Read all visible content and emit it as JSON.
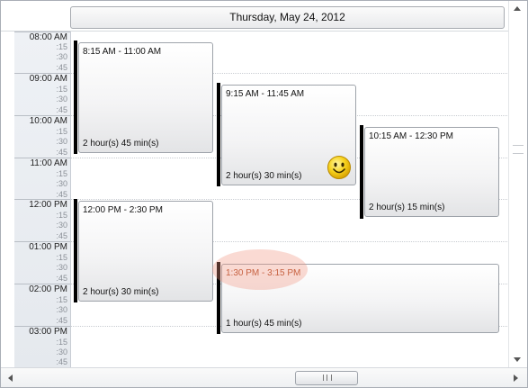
{
  "header": {
    "date": "Thursday, May 24, 2012"
  },
  "time_gutter": [
    {
      "hour": "08:00 AM",
      "quarters": [
        ":15",
        ":30",
        ":45"
      ]
    },
    {
      "hour": "09:00 AM",
      "quarters": [
        ":15",
        ":30",
        ":45"
      ]
    },
    {
      "hour": "10:00 AM",
      "quarters": [
        ":15",
        ":30",
        ":45"
      ]
    },
    {
      "hour": "11:00 AM",
      "quarters": [
        ":15",
        ":30",
        ":45"
      ]
    },
    {
      "hour": "12:00 PM",
      "quarters": [
        ":15",
        ":30",
        ":45"
      ]
    },
    {
      "hour": "01:00 PM",
      "quarters": [
        ":15",
        ":30",
        ":45"
      ]
    },
    {
      "hour": "02:00 PM",
      "quarters": [
        ":15",
        ":30",
        ":45"
      ]
    },
    {
      "hour": "03:00 PM",
      "quarters": [
        ":15",
        ":30",
        ":45"
      ]
    }
  ],
  "events": [
    {
      "time": "8:15 AM - 11:00 AM",
      "duration": "2 hour(s) 45 min(s)"
    },
    {
      "time": "9:15 AM - 11:45 AM",
      "duration": "2 hour(s) 30 min(s)",
      "icon": "smiley-icon"
    },
    {
      "time": "10:15 AM - 12:30 PM",
      "duration": "2 hour(s) 15 min(s)"
    },
    {
      "time": "12:00 PM - 2:30 PM",
      "duration": "2 hour(s) 30 min(s)"
    },
    {
      "time": "1:30 PM - 3:15 PM",
      "duration": "1 hour(s) 45 min(s)",
      "highlighted": true
    }
  ],
  "colors": {
    "event_bar": "#000000",
    "highlight": "#f0968280",
    "highlight_text": "#b0451e",
    "smiley": "#f7d31e"
  }
}
